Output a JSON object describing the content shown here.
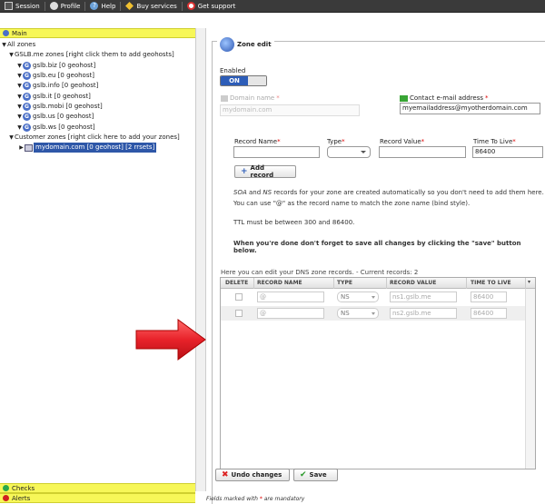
{
  "menu": [
    {
      "label": "Session",
      "icon": "session-icon"
    },
    {
      "label": "Profile",
      "icon": "profile-icon"
    },
    {
      "label": "Help",
      "icon": "help-icon"
    },
    {
      "label": "Buy services",
      "icon": "buy-services-icon"
    },
    {
      "label": "Get support",
      "icon": "get-support-icon"
    }
  ],
  "left": {
    "main_title": "Main",
    "tree": {
      "all_zones": "All zones",
      "gslb_group": "GSLB.me zones [right click them to add geohosts]",
      "gslb_zones": [
        "gslb.biz [0 geohost]",
        "gslb.eu [0 geohost]",
        "gslb.info [0 geohost]",
        "gslb.it [0 geohost]",
        "gslb.mobi [0 geohost]",
        "gslb.us [0 geohost]",
        "gslb.ws [0 geohost]"
      ],
      "customer_group": "Customer zones [right click here to add your zones]",
      "customer_zone": "mydomain.com [0 geohost] [2 rrsets]"
    },
    "checks_title": "Checks",
    "alerts_title": "Alerts"
  },
  "zone_edit": {
    "title": "Zone edit",
    "enabled_label": "Enabled",
    "toggle_on": "ON",
    "domain_name_label": "Domain name",
    "domain_name_value": "mydomain.com",
    "contact_label": "Contact e-mail address",
    "contact_value": "myemailaddress@myotherdomain.com",
    "required_mark": "*",
    "record_name_label": "Record Name",
    "type_label": "Type",
    "record_value_label": "Record Value",
    "ttl_label": "Time To Live",
    "ttl_value": "86400",
    "add_record_label": "Add record",
    "info_soa": "SOA",
    "info_and": " and ",
    "info_ns": "NS",
    "info_line1_rest": " records for your zone are created automatically so you don't need to add them here.",
    "info_line2": "You can use \"@\" as the record name to match the zone name (bind style).",
    "info_line3": "TTL must be between 300 and 86400.",
    "info_line4": "When you're done don't forget to save all changes by clicking the \"save\" button below.",
    "grid_caption": "Here you can edit your DNS zone records. - Current records: 2",
    "grid_headers": [
      "DELETE",
      "RECORD NAME",
      "TYPE",
      "RECORD VALUE",
      "TIME TO LIVE"
    ],
    "grid_rows": [
      {
        "name": "@",
        "type": "NS",
        "value": "ns1.gslb.me",
        "ttl": "86400"
      },
      {
        "name": "@",
        "type": "NS",
        "value": "ns2.gslb.me",
        "ttl": "86400"
      }
    ],
    "undo_label": "Undo changes",
    "save_label": "Save",
    "footer_note_pre": "Fields marked with ",
    "footer_note_star": "*",
    "footer_note_post": " are mandatory"
  },
  "colors": {
    "accent": "#2d5db8",
    "section_yellow": "#f7f758",
    "arrow_red": "#e8222a"
  }
}
